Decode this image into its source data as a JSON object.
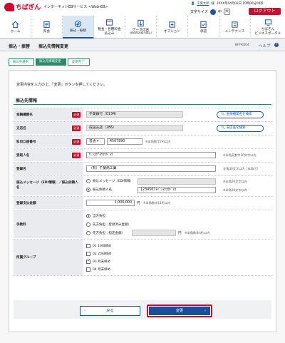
{
  "header": {
    "brand": "ちばぎん",
    "service": "インターネットEBサービス <Web-EB>",
    "user_name": "千葉太郎",
    "user_suffix": "様",
    "last_login": "20XX年04月02日 10時00分00秒",
    "font_size_label": "文字サイズ",
    "font_medium": "中",
    "font_large": "大",
    "logout_label": "ログアウト"
  },
  "nav": [
    {
      "label": "ホーム",
      "icon": "home-icon"
    },
    {
      "label": "照会",
      "icon": "inquiry-icon"
    },
    {
      "label": "振込・振替",
      "icon": "transfer-icon"
    },
    {
      "label": "税金・各種料金\n払込み",
      "icon": "tax-icon"
    },
    {
      "label": "データ伝送",
      "sub": "(総合振込/給与振込)",
      "icon": "data-icon"
    },
    {
      "label": "オプション",
      "icon": "option-icon"
    },
    {
      "label": "承認",
      "icon": "approve-icon"
    },
    {
      "label": "メンテナンス",
      "icon": "maintenance-icon"
    },
    {
      "label": "ちばぎん\nビジネスポータル",
      "icon": "portal-icon"
    }
  ],
  "page": {
    "title": "振込・振替　　振込先情報変更",
    "screen_id": "BFFK004",
    "help": "ヘルプ"
  },
  "steps": [
    "振込先選択",
    "振込先情報変更",
    "変更完了"
  ],
  "instruction": "変更内容を入力の上、「変更」ボタンを押してください。",
  "section_title": "振込先情報",
  "required_label": "必須",
  "form": {
    "bank_label": "金融機関名",
    "bank_value": "千葉銀行（0134）",
    "bank_search": "金融機関名を検索",
    "branch_label": "支店名",
    "branch_value": "成田支店（286）",
    "branch_search": "支店名を検索",
    "account_label": "科目口座番号",
    "account_type": "普通",
    "account_number": "4567890",
    "account_note": "※半角数字7桁以内",
    "recipient_label": "受取人名",
    "recipient_value": "ｾﾞﾝｶｸ\"ﾖｳｺｳｷﾞｮｳ",
    "recipient_note": "※半角英数字30文字以内",
    "reg_name_label": "登録名",
    "reg_name_value": "（有）千葉商工業",
    "reg_name_note": "全角30文字以内［半角可］",
    "edi_label": "振込メッセージ（EDI情報）／振込依頼人名",
    "edi_opt1": "振込メッセージ（EDI情報）",
    "edi_note1": "※半角20文字以内",
    "edi_opt2": "振込依頼人名",
    "edi_value2": "1234567ﾁﾊﾞｼｮｳｺｳｷﾞｮｳ",
    "edi_note2": "※半角20文字以内",
    "amount_label": "登録支払金額",
    "amount_value": "1,000,000",
    "amount_unit": "円",
    "amount_note": "※半角数字11桁以内",
    "fee_label": "手数料",
    "fee_opt1": "当方負担",
    "fee_opt2": "先方負担（登録済み金額）",
    "fee_opt3": "先方負担（指定金額）",
    "fee_unit": "円",
    "fee_note": "※半角数字4桁以内",
    "group_label": "所属グループ",
    "groups": [
      {
        "label": "01 10日締め",
        "checked": false
      },
      {
        "label": "02 20日締め",
        "checked": false
      },
      {
        "label": "03 月末締め",
        "checked": true
      },
      {
        "label": "04 月末締め",
        "checked": false
      }
    ]
  },
  "buttons": {
    "back": "戻る",
    "submit": "変更"
  },
  "colors": {
    "brand_red": "#d8002c",
    "primary_blue": "#1a4e9a",
    "step_green": "#2a8a6a"
  }
}
